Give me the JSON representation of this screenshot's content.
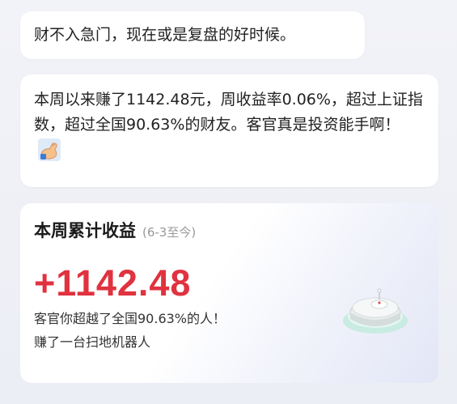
{
  "messages": {
    "m1": "财不入急门，现在或是复盘的好时候。",
    "m2": "本周以来赚了1142.48元，周收益率0.06%，超过上证指数，超过全国90.63%的财友。客官真是投资能手啊！",
    "m2_emoji": "flexed-biceps-icon"
  },
  "card": {
    "title": "本周累计收益",
    "date_range": "(6-3至今)",
    "profit": "+1142.48",
    "line1": "客官你超越了全国90.63%的人！",
    "line2": "赚了一台扫地机器人",
    "reward_icon": "robot-vacuum-icon"
  },
  "colors": {
    "profit": "#e0323f",
    "background": "#f2f3f8"
  }
}
